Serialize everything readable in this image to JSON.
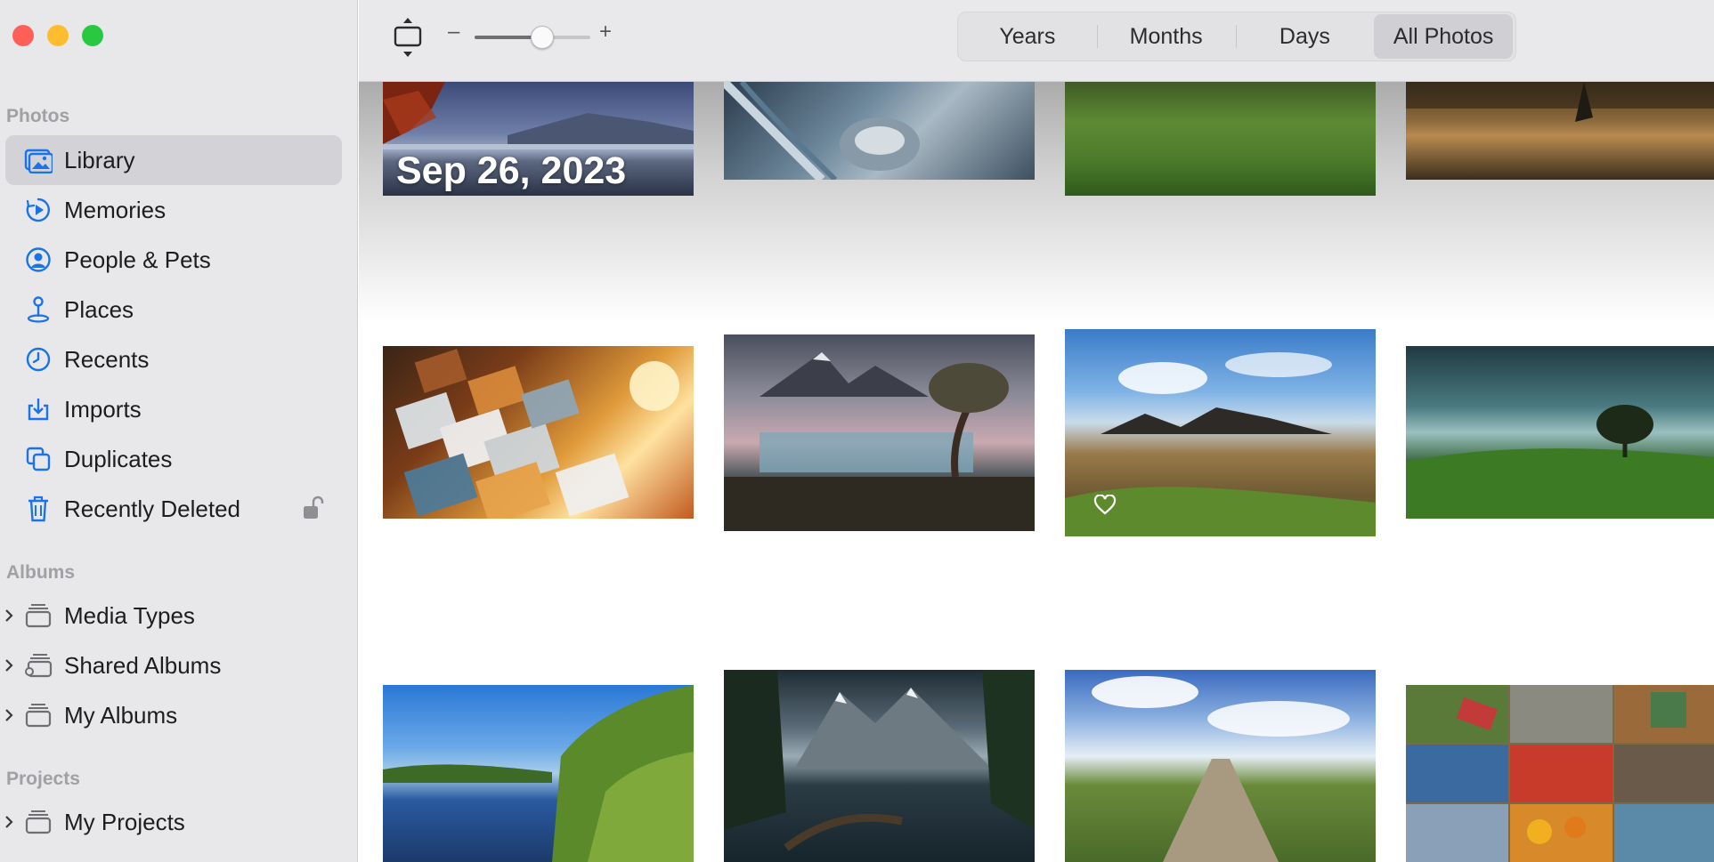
{
  "window": {
    "traffic_lights": {
      "close": "#ff5f57",
      "minimize": "#febc2e",
      "zoom": "#28c840"
    }
  },
  "sidebar": {
    "sections": {
      "photos": "Photos",
      "albums": "Albums",
      "projects": "Projects"
    },
    "items": [
      {
        "label": "Library",
        "icon": "library-icon",
        "active": true
      },
      {
        "label": "Memories",
        "icon": "memories-icon"
      },
      {
        "label": "People & Pets",
        "icon": "people-icon"
      },
      {
        "label": "Places",
        "icon": "places-icon"
      },
      {
        "label": "Recents",
        "icon": "clock-icon"
      },
      {
        "label": "Imports",
        "icon": "import-icon"
      },
      {
        "label": "Duplicates",
        "icon": "duplicates-icon"
      },
      {
        "label": "Recently Deleted",
        "icon": "trash-icon",
        "lock": "lock-icon"
      }
    ],
    "albums": [
      {
        "label": "Media Types",
        "icon": "album-stack-icon"
      },
      {
        "label": "Shared Albums",
        "icon": "shared-album-icon"
      },
      {
        "label": "My Albums",
        "icon": "album-stack-icon"
      }
    ],
    "projects": [
      {
        "label": "My Projects",
        "icon": "album-stack-icon"
      }
    ],
    "accent_color": "#1a73e8"
  },
  "toolbar": {
    "zoom_minus": "–",
    "zoom_plus": "+",
    "zoom_level": 0.58,
    "tabs": [
      {
        "label": "Years"
      },
      {
        "label": "Months"
      },
      {
        "label": "Days"
      },
      {
        "label": "All Photos",
        "active": true
      }
    ]
  },
  "grid": {
    "date_header": "Sep 26, 2023",
    "favorite_icon": "heart-icon"
  }
}
